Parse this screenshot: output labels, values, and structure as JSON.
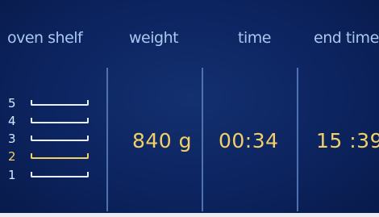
{
  "headers": {
    "oven_shelf": "oven shelf",
    "weight": "weight",
    "time": "time",
    "end_time": "end time"
  },
  "shelves": [
    {
      "label": "5",
      "selected": false
    },
    {
      "label": "4",
      "selected": false
    },
    {
      "label": "3",
      "selected": false
    },
    {
      "label": "2",
      "selected": true
    },
    {
      "label": "1",
      "selected": false
    }
  ],
  "values": {
    "weight": "840 g",
    "time": "00:34",
    "end_time": "15 :39"
  },
  "colors": {
    "background": "#0c2460",
    "header_text": "#a9c8ee",
    "highlight": "#f2d066",
    "shelf_default": "#e6f0ff"
  }
}
